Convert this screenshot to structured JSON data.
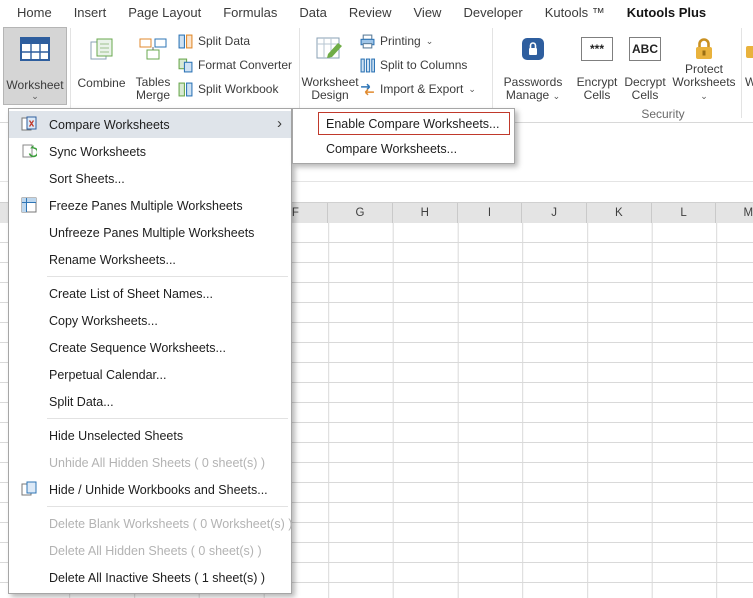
{
  "tab_bar": {
    "tabs": [
      "Home",
      "Insert",
      "Page Layout",
      "Formulas",
      "Data",
      "Review",
      "View",
      "Developer",
      "Kutools ™",
      "Kutools Plus"
    ],
    "active": "Kutools Plus"
  },
  "icons": {
    "chevron_down": "⌄",
    "submenu_arrow": "›"
  },
  "colors": {
    "annotation_red": "#c0392b",
    "pressed_button_bg": "#d5d5d5"
  },
  "ribbon": {
    "worksheet_btn": {
      "label": "Worksheet"
    },
    "combine_btn": {
      "label": "Combine"
    },
    "tables_merge_btn": {
      "line1": "Tables",
      "line2": "Merge"
    },
    "split_data_btn": {
      "label": "Split Data"
    },
    "format_converter_btn": {
      "label": "Format Converter"
    },
    "split_workbook_btn": {
      "label": "Split Workbook"
    },
    "worksheet_design_btn": {
      "line1": "Worksheet",
      "line2": "Design"
    },
    "printing_btn": {
      "label": "Printing"
    },
    "split_to_columns_btn": {
      "label": "Split to Columns"
    },
    "import_export_btn": {
      "label": "Import & Export"
    },
    "passwords_manage_btn": {
      "line1": "Passwords",
      "line2": "Manage"
    },
    "encrypt_cells_btn": {
      "line1": "Encrypt",
      "line2": "Cells",
      "icon_text": "***"
    },
    "decrypt_cells_btn": {
      "line1": "Decrypt",
      "line2": "Cells",
      "icon_text": "ABC"
    },
    "protect_worksheets_btn": {
      "line1": "Protect",
      "line2": "Worksheets"
    },
    "partial_btn": {
      "label": "W"
    },
    "group_label": "Security"
  },
  "menu": {
    "items": [
      {
        "label": "Compare Worksheets",
        "disabled": false,
        "has_submenu": true,
        "selected": true
      },
      {
        "label": "Sync Worksheets",
        "disabled": false
      },
      {
        "label": "Sort Sheets...",
        "disabled": false
      },
      {
        "label": "Freeze Panes Multiple Worksheets",
        "disabled": false
      },
      {
        "label": "Unfreeze Panes Multiple Worksheets",
        "disabled": false
      },
      {
        "label": "Rename Worksheets...",
        "disabled": false
      },
      {
        "label": "Create List of Sheet Names...",
        "disabled": false
      },
      {
        "label": "Copy Worksheets...",
        "disabled": false
      },
      {
        "label": "Create Sequence Worksheets...",
        "disabled": false
      },
      {
        "label": "Perpetual Calendar...",
        "disabled": false
      },
      {
        "label": "Split Data...",
        "disabled": false
      },
      {
        "label": "Hide Unselected Sheets",
        "disabled": false
      },
      {
        "label": "Unhide All Hidden Sheets ( 0 sheet(s) )",
        "disabled": true
      },
      {
        "label": "Hide / Unhide Workbooks and Sheets...",
        "disabled": false
      },
      {
        "label": "Delete Blank Worksheets ( 0 Worksheet(s) )",
        "disabled": true
      },
      {
        "label": "Delete All Hidden Sheets ( 0 sheet(s) )",
        "disabled": true
      },
      {
        "label": "Delete All Inactive Sheets ( 1 sheet(s) )",
        "disabled": false
      }
    ]
  },
  "submenu": {
    "items": [
      "Enable Compare Worksheets...",
      "Compare Worksheets..."
    ]
  },
  "grid": {
    "columns": [
      "F",
      "G",
      "H",
      "I",
      "J",
      "K",
      "L",
      "M"
    ]
  }
}
